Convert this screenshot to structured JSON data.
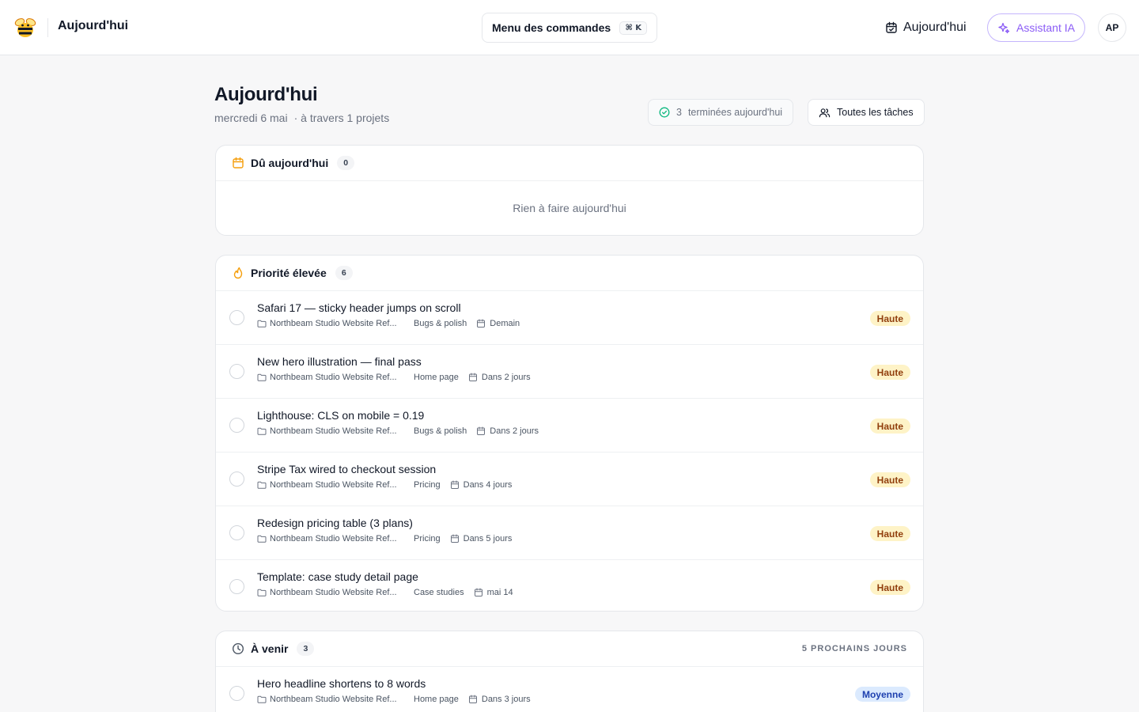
{
  "topbar": {
    "title": "Aujourd'hui",
    "command_menu_label": "Menu des commandes",
    "command_shortcut": "⌘ K",
    "today_link": "Aujourd'hui",
    "ai_button": "Assistant IA",
    "avatar_initials": "AP"
  },
  "header": {
    "title": "Aujourd'hui",
    "date": "mercredi 6 mai",
    "projects_note": "· à travers 1 projets",
    "done_count": "3",
    "done_label": "terminées aujourd'hui",
    "all_tasks_button": "Toutes les tâches"
  },
  "due_today": {
    "title": "Dû aujourd'hui",
    "count": "0",
    "empty_message": "Rien à faire aujourd'hui"
  },
  "high_priority": {
    "title": "Priorité élevée",
    "count": "6",
    "tasks": [
      {
        "title": "Safari 17 — sticky header jumps on scroll",
        "project": "Northbeam Studio Website Ref...",
        "section": "Bugs & polish",
        "due": "Demain",
        "priority": "Haute"
      },
      {
        "title": "New hero illustration — final pass",
        "project": "Northbeam Studio Website Ref...",
        "section": "Home page",
        "due": "Dans 2 jours",
        "priority": "Haute"
      },
      {
        "title": "Lighthouse: CLS on mobile = 0.19",
        "project": "Northbeam Studio Website Ref...",
        "section": "Bugs & polish",
        "due": "Dans 2 jours",
        "priority": "Haute"
      },
      {
        "title": "Stripe Tax wired to checkout session",
        "project": "Northbeam Studio Website Ref...",
        "section": "Pricing",
        "due": "Dans 4 jours",
        "priority": "Haute"
      },
      {
        "title": "Redesign pricing table (3 plans)",
        "project": "Northbeam Studio Website Ref...",
        "section": "Pricing",
        "due": "Dans 5 jours",
        "priority": "Haute"
      },
      {
        "title": "Template: case study detail page",
        "project": "Northbeam Studio Website Ref...",
        "section": "Case studies",
        "due": "mai 14",
        "priority": "Haute"
      }
    ]
  },
  "upcoming": {
    "title": "À venir",
    "count": "3",
    "range_label": "5 PROCHAINS JOURS",
    "tasks": [
      {
        "title": "Hero headline shortens to 8 words",
        "project": "Northbeam Studio Website Ref...",
        "section": "Home page",
        "due": "Dans 3 jours",
        "priority": "Moyenne"
      }
    ]
  },
  "icons": {
    "logo": "bee-logo-icon",
    "today": "calendar-check-icon",
    "ai": "sparkles-icon",
    "done": "check-circle-icon",
    "all_tasks": "users-icon",
    "due_today": "calendar-icon",
    "high_priority": "flame-icon",
    "upcoming": "clock-icon",
    "project": "folder-icon",
    "due": "calendar-icon"
  },
  "colors": {
    "accent_orange": "#f59e0b",
    "ai_purple": "#8b5cf6",
    "done_green": "#10b981",
    "high_bg": "#fef3c7",
    "high_text": "#92400e",
    "medium_bg": "#dbeafe",
    "medium_text": "#1e40af"
  }
}
